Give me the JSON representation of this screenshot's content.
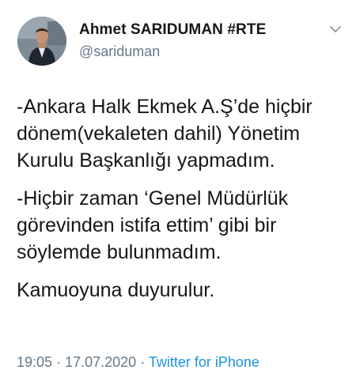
{
  "author": {
    "name": "Ahmet SARIDUMAN #RTE",
    "handle": "@sariduman"
  },
  "tweet": {
    "paragraphs": [
      "-Ankara Halk Ekmek A.Ş’de hiçbir\ndönem(vekaleten dahil) Yönetim\nKurulu Başkanlığı yapmadım.",
      "-Hiçbir zaman  ‘Genel Müdürlük\ngörevinden istifa ettim’ gibi bir\nsöylemde bulunmadım.",
      "Kamuoyuna duyurulur."
    ]
  },
  "meta": {
    "time": "19:05",
    "separator": "·",
    "date": "17.07.2020",
    "source": "Twitter for iPhone"
  },
  "icons": {
    "menu": "chevron-down-icon"
  },
  "colors": {
    "text": "#14171a",
    "secondary": "#657786",
    "link": "#1b95e0"
  }
}
